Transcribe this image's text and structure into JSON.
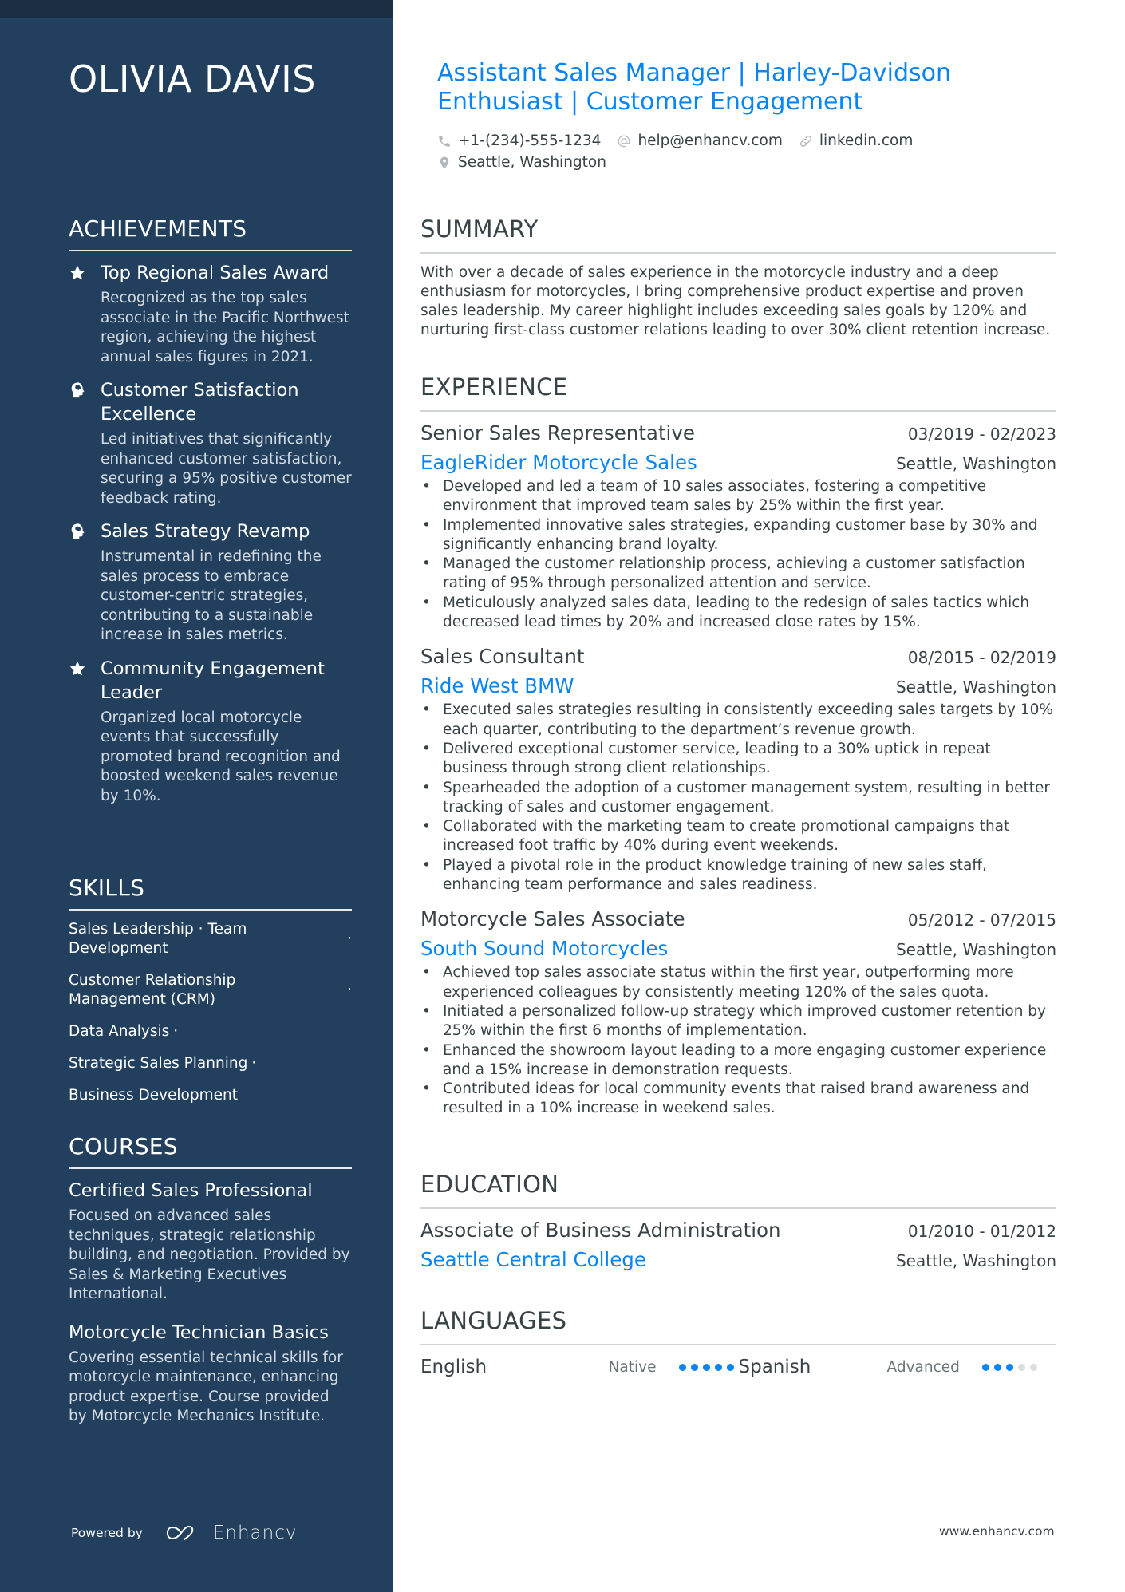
{
  "colors": {
    "sidebar": "#22405e",
    "accent": "#0a84f0",
    "text": "#384347"
  },
  "name": "OLIVIA DAVIS",
  "title": "Assistant Sales Manager | Harley-Davidson Enthusiast | Customer Engagement",
  "contacts": {
    "phone": {
      "icon": "phone-icon",
      "value": "+1-(234)-555-1234"
    },
    "email": {
      "icon": "at-icon",
      "value": "help@enhancv.com"
    },
    "link": {
      "icon": "link-icon",
      "value": "linkedin.com"
    },
    "location": {
      "icon": "location-pin-icon",
      "value": "Seattle, Washington"
    }
  },
  "achievements": {
    "heading": "ACHIEVEMENTS",
    "items": [
      {
        "icon": "star-icon",
        "title": "Top Regional Sales Award",
        "desc": "Recognized as the top sales associate in the Pacific Northwest region, achieving the highest annual sales figures in 2021."
      },
      {
        "icon": "brain-head-icon",
        "title": "Customer Satisfaction Excellence",
        "desc": "Led initiatives that significantly enhanced customer satisfaction, securing a 95% positive customer feedback rating."
      },
      {
        "icon": "brain-head-icon",
        "title": "Sales Strategy Revamp",
        "desc": "Instrumental in redefining the sales process to embrace customer-centric strategies, contributing to a sustainable increase in sales metrics."
      },
      {
        "icon": "star-icon",
        "title": "Community Engagement Leader",
        "desc": "Organized local motorcycle events that successfully promoted brand recognition and boosted weekend sales revenue by 10%."
      }
    ]
  },
  "skills": {
    "heading": "SKILLS",
    "lines": [
      {
        "text": "Sales Leadership · Team Development",
        "sep": "·"
      },
      {
        "text": "Customer Relationship Management (CRM)",
        "sep": "·"
      },
      {
        "text": "Data Analysis",
        "sep": "·"
      },
      {
        "text": "Strategic Sales Planning",
        "sep": "·"
      },
      {
        "text": "Business Development",
        "sep": ""
      }
    ]
  },
  "courses": {
    "heading": "COURSES",
    "items": [
      {
        "title": "Certified Sales Professional",
        "desc": "Focused on advanced sales techniques, strategic relationship building, and negotiation. Provided by Sales & Marketing Executives International."
      },
      {
        "title": "Motorcycle Technician Basics",
        "desc": "Covering essential technical skills for motorcycle maintenance, enhancing product expertise. Course provided by Motorcycle Mechanics Institute."
      }
    ]
  },
  "summary": {
    "heading": "SUMMARY",
    "text": "With over a decade of sales experience in the motorcycle industry and a deep enthusiasm for motorcycles, I bring comprehensive product expertise and proven sales leadership. My career highlight includes exceeding sales goals by 120% and nurturing first-class customer relations leading to over 30% client retention increase."
  },
  "experience": {
    "heading": "EXPERIENCE",
    "jobs": [
      {
        "title": "Senior Sales Representative",
        "dates": "03/2019 - 02/2023",
        "company": "EagleRider Motorcycle Sales",
        "location": "Seattle, Washington",
        "bullets": [
          "Developed and led a team of 10 sales associates, fostering a competitive environment that improved team sales by 25% within the first year.",
          "Implemented innovative sales strategies, expanding customer base by 30% and significantly enhancing brand loyalty.",
          "Managed the customer relationship process, achieving a customer satisfaction rating of 95% through personalized attention and service.",
          "Meticulously analyzed sales data, leading to the redesign of sales tactics which decreased lead times by 20% and increased close rates by 15%."
        ]
      },
      {
        "title": "Sales Consultant",
        "dates": "08/2015 - 02/2019",
        "company": "Ride West BMW",
        "location": "Seattle, Washington",
        "bullets": [
          "Executed sales strategies resulting in consistently exceeding sales targets by 10% each quarter, contributing to the department’s revenue growth.",
          "Delivered exceptional customer service, leading to a 30% uptick in repeat business through strong client relationships.",
          "Spearheaded the adoption of a customer management system, resulting in better tracking of sales and customer engagement.",
          "Collaborated with the marketing team to create promotional campaigns that increased foot traffic by 40% during event weekends.",
          "Played a pivotal role in the product knowledge training of new sales staff, enhancing team performance and sales readiness."
        ]
      },
      {
        "title": "Motorcycle Sales Associate",
        "dates": "05/2012 - 07/2015",
        "company": "South Sound Motorcycles",
        "location": "Seattle, Washington",
        "bullets": [
          "Achieved top sales associate status within the first year, outperforming more experienced colleagues by consistently meeting 120% of the sales quota.",
          "Initiated a personalized follow-up strategy which improved customer retention by 25% within the first 6 months of implementation.",
          "Enhanced the showroom layout leading to a more engaging customer experience and a 15% increase in demonstration requests.",
          "Contributed ideas for local community events that raised brand awareness and resulted in a 10% increase in weekend sales."
        ]
      }
    ]
  },
  "education": {
    "heading": "EDUCATION",
    "items": [
      {
        "degree": "Associate of Business Administration",
        "dates": "01/2010 - 01/2012",
        "school": "Seattle Central College",
        "location": "Seattle, Washington"
      }
    ]
  },
  "languages": {
    "heading": "LANGUAGES",
    "items": [
      {
        "name": "English",
        "level": "Native",
        "rating": 5,
        "max": 5
      },
      {
        "name": "Spanish",
        "level": "Advanced",
        "rating": 3,
        "max": 5
      }
    ]
  },
  "footer": {
    "powered_by": "Powered by",
    "brand": "Enhancv",
    "url": "www.enhancv.com"
  }
}
